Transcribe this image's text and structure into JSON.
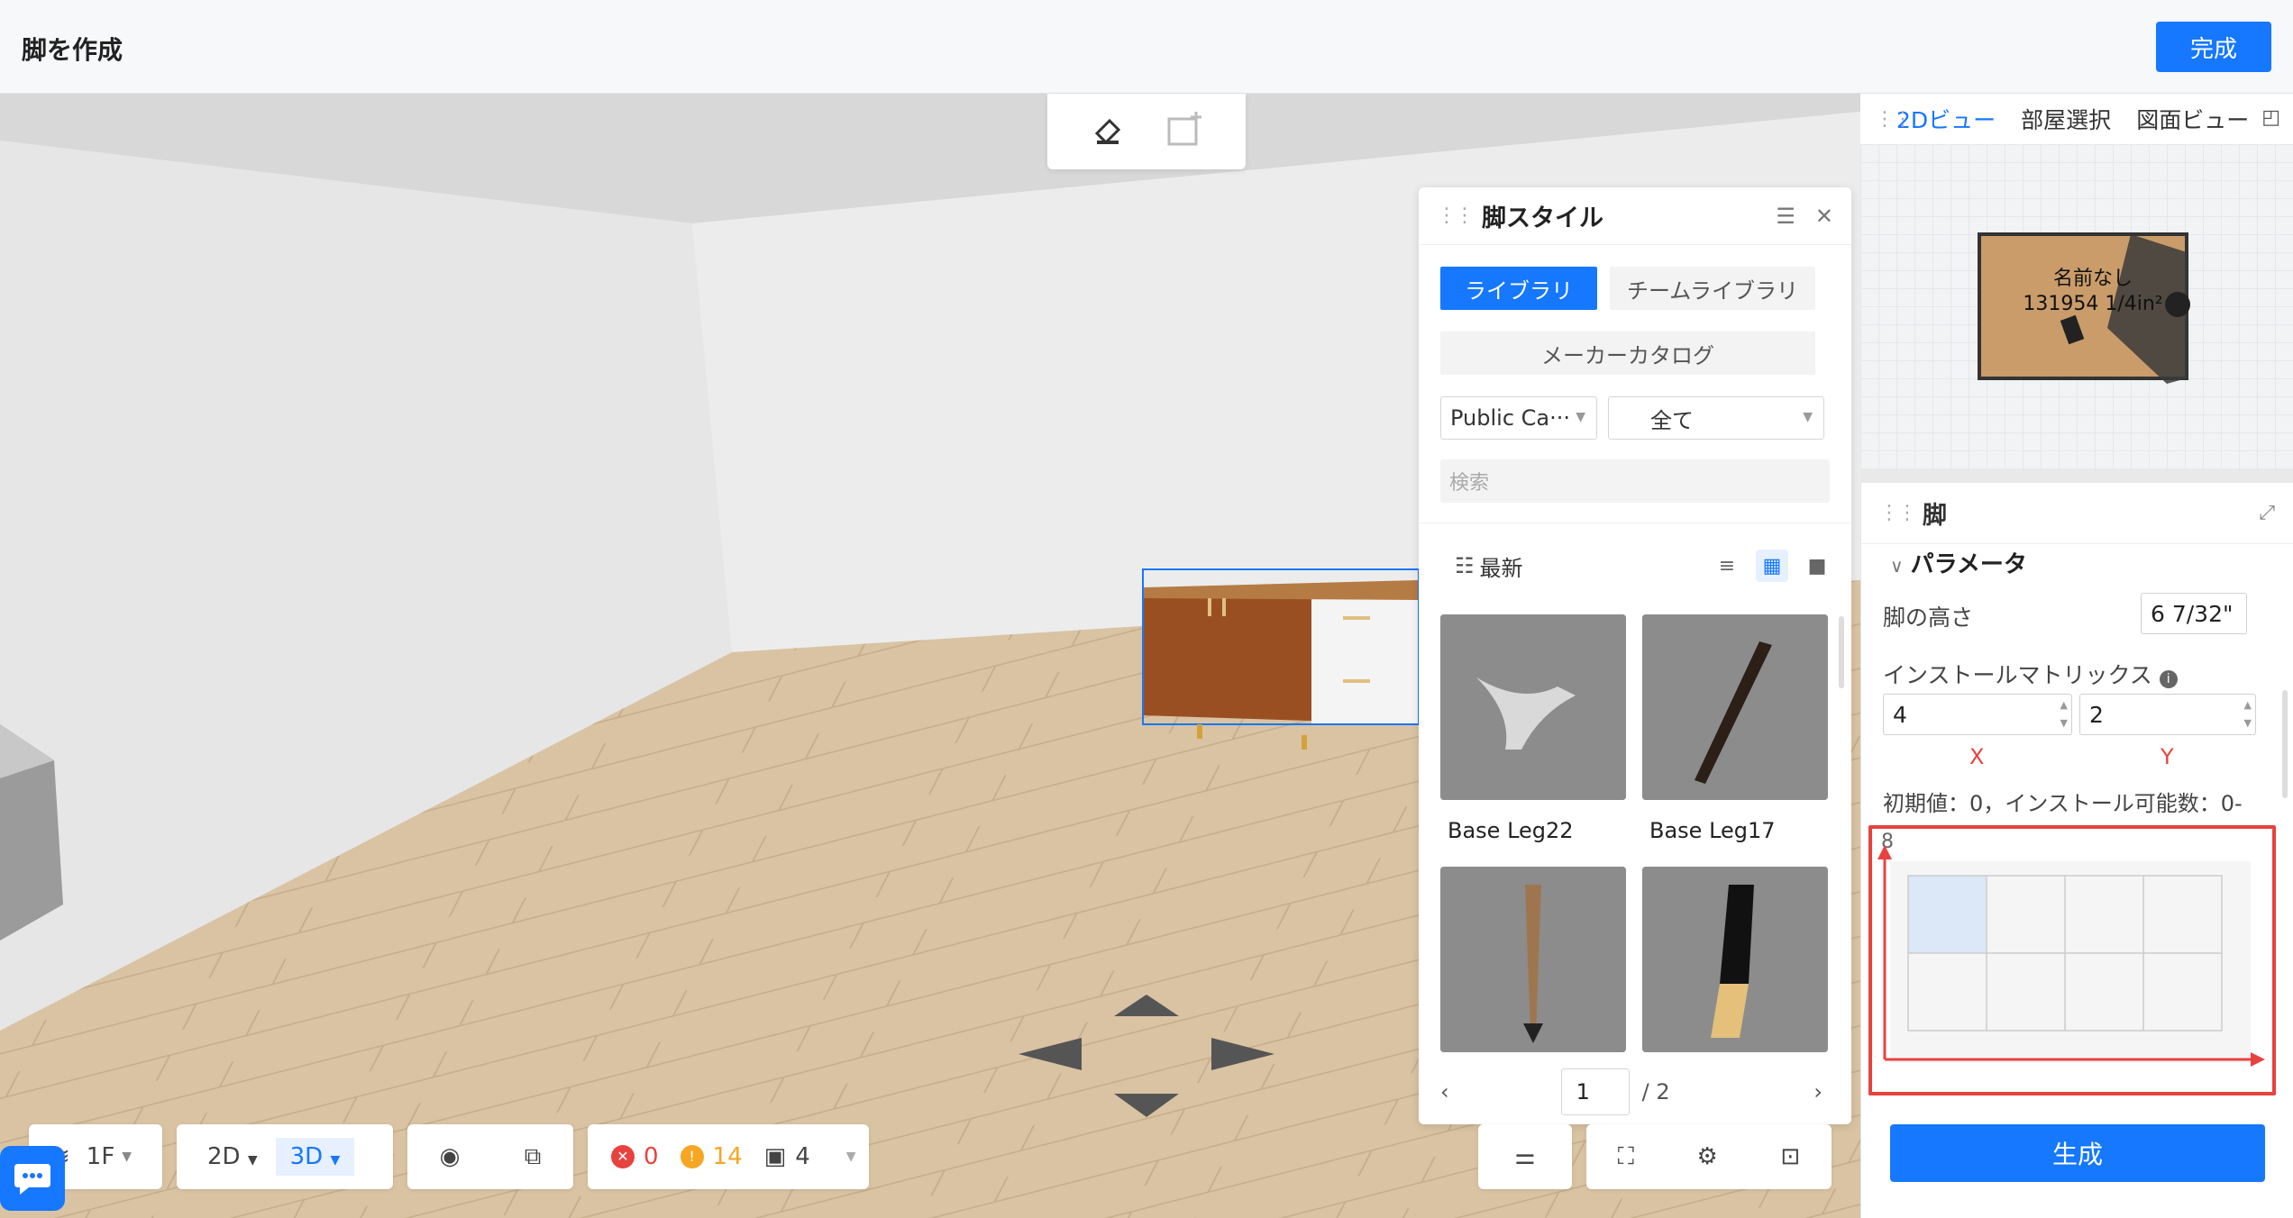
{
  "header": {
    "title": "脚を作成",
    "done_label": "完成"
  },
  "leg_panel": {
    "title": "脚スタイル",
    "tabs": [
      "ライブラリ",
      "チームライブラリ"
    ],
    "maker_catalog": "メーカーカタログ",
    "catalog_select": "Public Ca···",
    "filter_select": "全て",
    "search_placeholder": "検索",
    "sort_label": "最新",
    "items": [
      {
        "name": "Base Leg22"
      },
      {
        "name": "Base Leg17"
      },
      {
        "name": ""
      },
      {
        "name": ""
      }
    ],
    "pager": {
      "current": "1",
      "total": "/ 2"
    }
  },
  "map_panel": {
    "tabs": [
      "2Dビュー",
      "部屋選択",
      "図面ビュー"
    ],
    "room_name": "名前なし",
    "room_area": "131954 1/4in²"
  },
  "param_panel": {
    "title": "脚",
    "section": "パラメータ",
    "height_label": "脚の高さ",
    "height_value": "6 7/32\"",
    "matrix_label": "インストールマトリックス",
    "matrix_x": "4",
    "matrix_y": "2",
    "x_axis": "X",
    "y_axis": "Y",
    "note": "初期値：0，インストール可能数：0-",
    "matrix_max": "8",
    "generate_label": "生成"
  },
  "bottom_bar": {
    "floor": "1F",
    "view_2d": "2D",
    "view_3d": "3D",
    "errors": "0",
    "warnings": "14",
    "items": "4"
  },
  "colors": {
    "accent": "#1677ff",
    "highlight": "#e8423f"
  }
}
